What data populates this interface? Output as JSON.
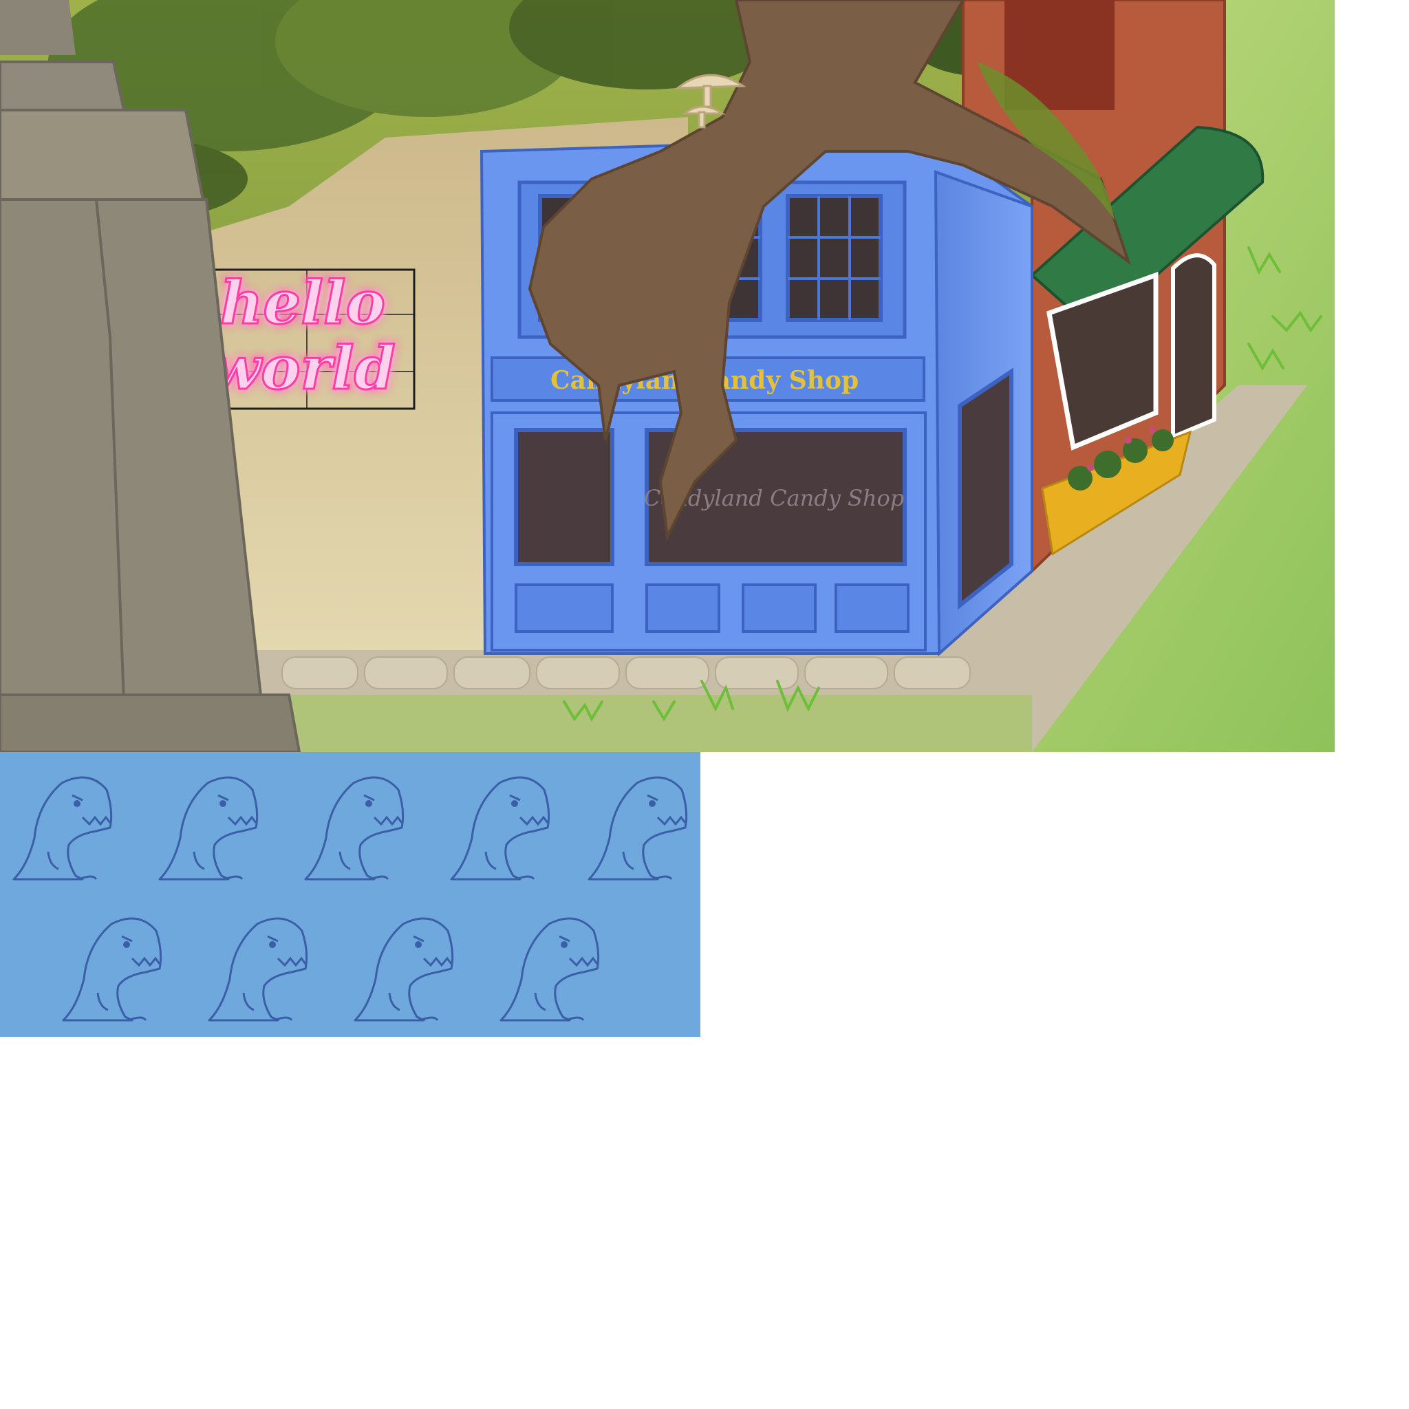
{
  "scene": {
    "neon_sign": {
      "line1": "hello",
      "line2": "world",
      "color": "#ff3aa6"
    },
    "candy_shop": {
      "fascia_text_left": "Candyland",
      "fascia_text_right": "Candy Shop",
      "window_text": "Candyland Candy Shop",
      "body_color": "#6a96f0",
      "sign_text_color": "#e3c23a"
    },
    "neighbor_building": {
      "brick_color": "#b85a3c",
      "awning_color": "#2f7a45"
    },
    "flower_box_color": "#e8b020",
    "mushroom_color": "#e8d7b4"
  },
  "dino_strip": {
    "background": "#6fa8dc",
    "dino_count": 9,
    "rows": [
      5,
      4
    ],
    "icon": "dinosaur-icon"
  }
}
